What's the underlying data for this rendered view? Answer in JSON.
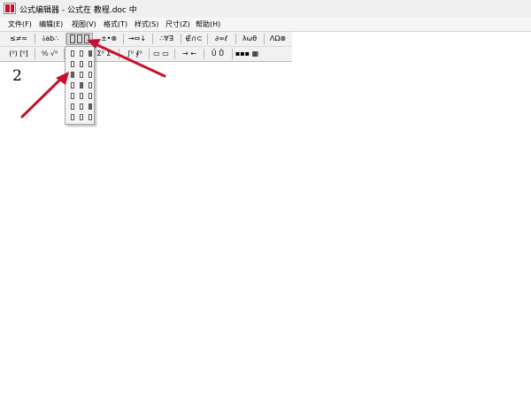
{
  "window": {
    "title": "公式编辑器 - 公式在 教程.doc 中"
  },
  "menu": [
    "文件(F)",
    "编辑(E)",
    "视图(V)",
    "格式(T)",
    "样式(S)",
    "尺寸(Z)",
    "帮助(H)"
  ],
  "toolbar_row1": [
    "≤≠≈",
    "⫰ab∴",
    "",
    "±•⊗",
    "→⇔↓",
    "∴∀∃",
    "∉∩⊂",
    "∂∞ℓ",
    "λωθ",
    "ΛΩ⊗"
  ],
  "toolbar_row2": [
    "(⁰) [⁰]",
    "⁰⁄₀ √⁰",
    "",
    "Σ⁰ Σ⁰",
    "∫⁰ ∮⁰",
    "▭ ▭",
    "→ ←",
    "Ū Ů",
    "▪▪▪ ▦"
  ],
  "editor": {
    "content": "2"
  },
  "colors": {
    "arrow": "#c8102e",
    "toolbar_bg": "#f1f1f1",
    "titlebar_bg": "#f0f0f0"
  }
}
